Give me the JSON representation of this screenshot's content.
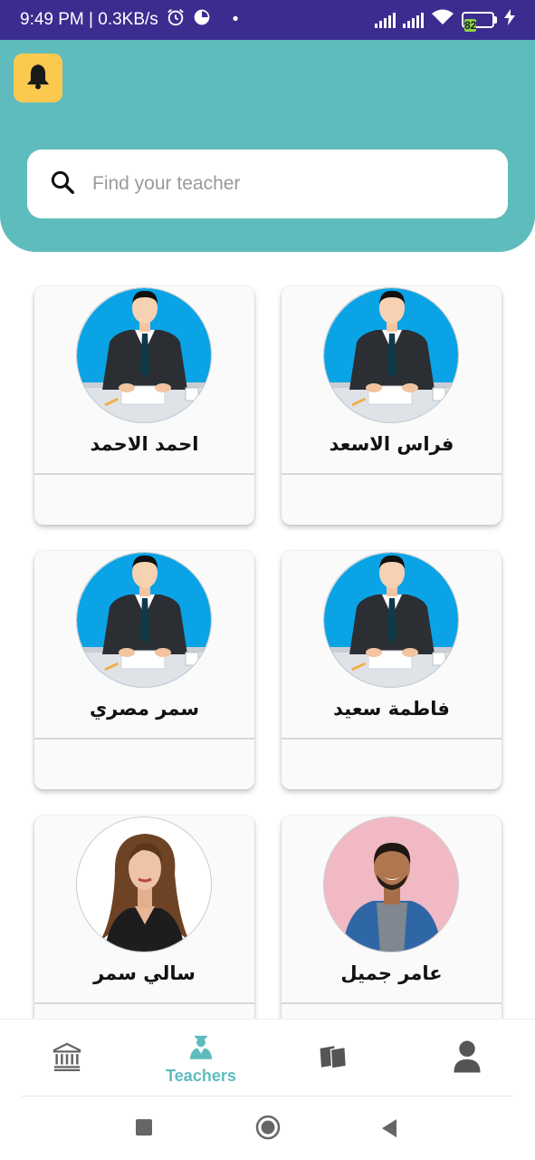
{
  "status_bar": {
    "time_speed": "9:49 PM | 0.3KB/s",
    "dot": "•",
    "battery_level": "82"
  },
  "header": {
    "notification_icon": "bell-icon"
  },
  "search": {
    "placeholder": "Find your teacher",
    "icon": "search-icon"
  },
  "teachers": [
    {
      "name": "فراس الاسعد",
      "photo": "illustration"
    },
    {
      "name": "احمد الاحمد",
      "photo": "illustration"
    },
    {
      "name": "فاطمة سعيد",
      "photo": "illustration"
    },
    {
      "name": "سمر مصري",
      "photo": "illustration"
    },
    {
      "name": "عامر جميل",
      "photo": "man-photo"
    },
    {
      "name": "سالي سمر",
      "photo": "woman-photo"
    }
  ],
  "bottom_nav": {
    "items": [
      {
        "icon": "institution-icon",
        "label": ""
      },
      {
        "icon": "teacher-icon",
        "label": "Teachers",
        "active": true
      },
      {
        "icon": "books-icon",
        "label": ""
      },
      {
        "icon": "profile-icon",
        "label": ""
      }
    ],
    "active_color": "#5fbcbd"
  },
  "colors": {
    "status_bar": "#3b2d8f",
    "header": "#5fbcbd",
    "bell_button": "#fcc94f"
  }
}
